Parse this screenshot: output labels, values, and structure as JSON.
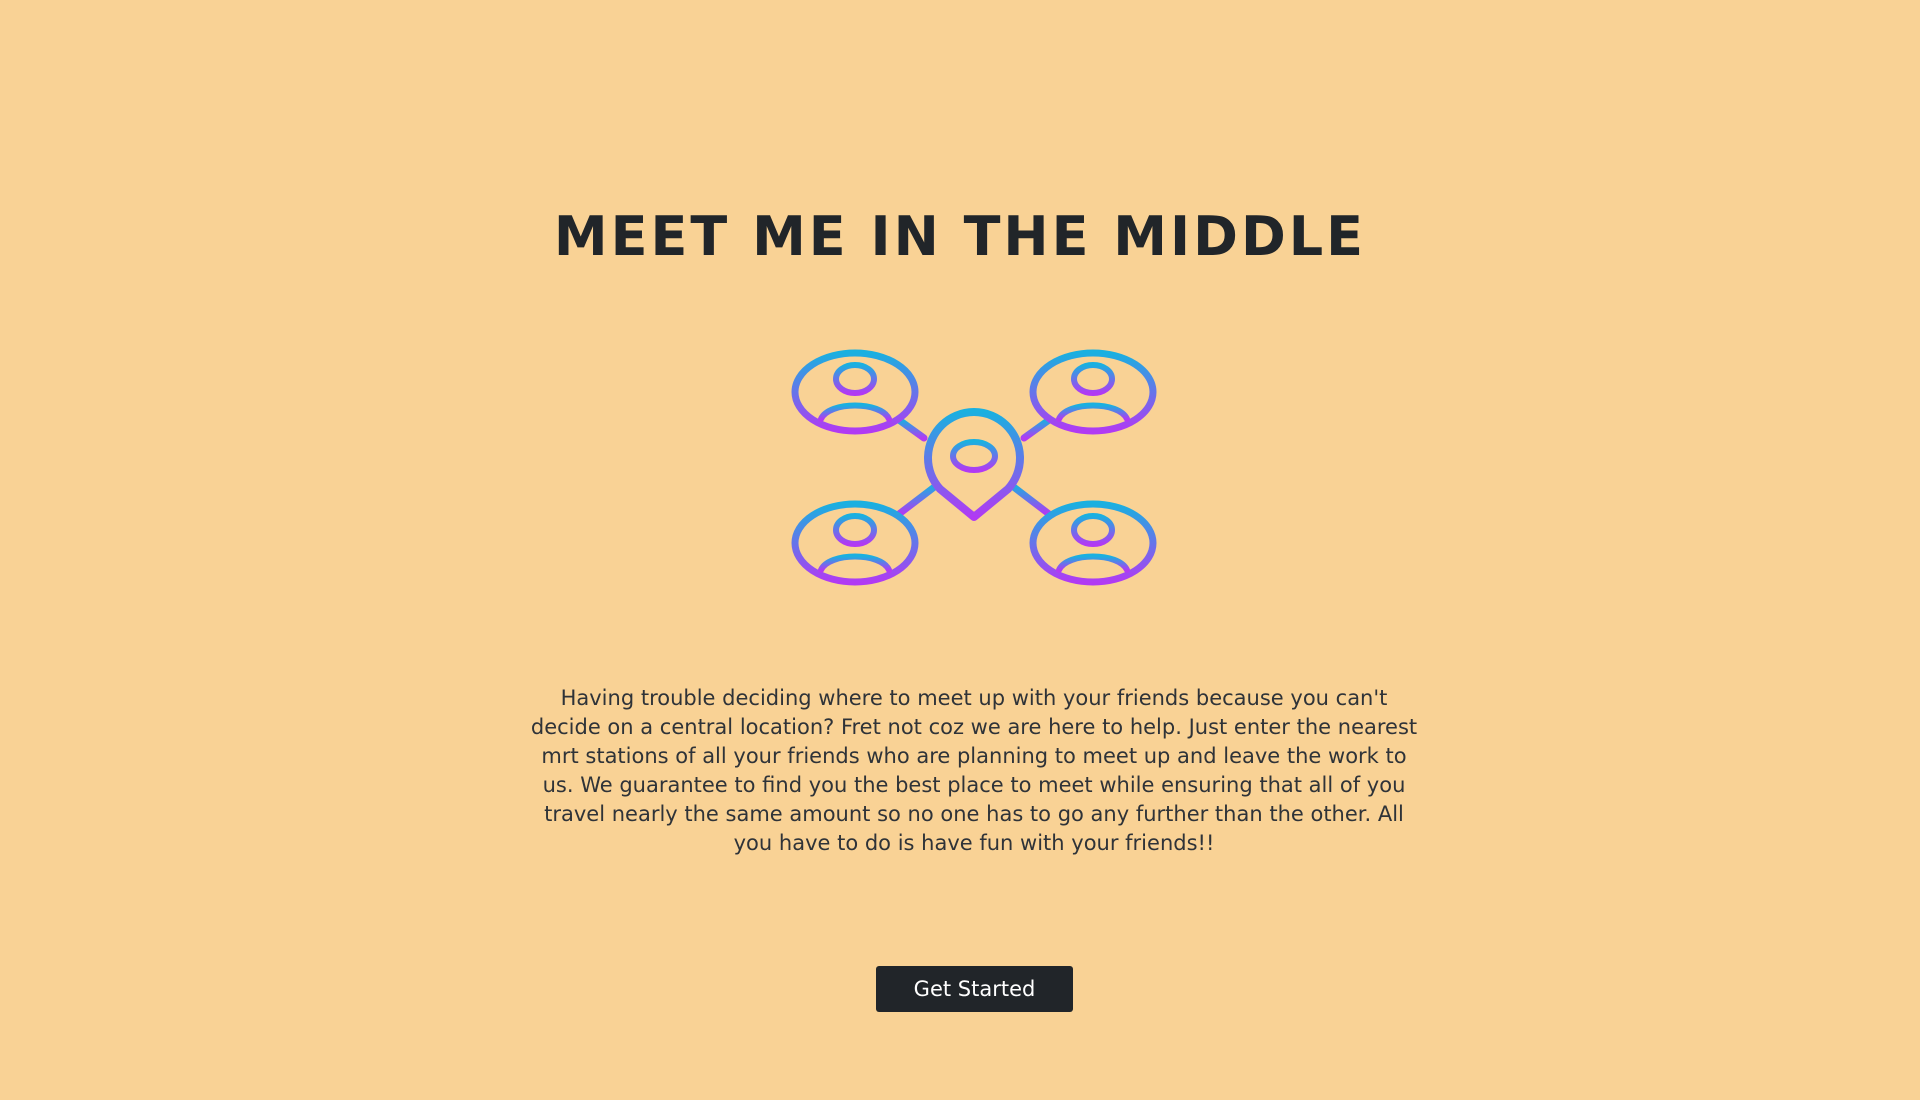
{
  "page": {
    "background_color": "#f9d295"
  },
  "hero": {
    "title": "MEET ME IN THE MIDDLE",
    "logo_icon": "meetup-location-network-icon",
    "logo_gradient": [
      "#1ab0e0",
      "#b13af3"
    ],
    "description": "Having trouble deciding where to meet up with your friends because you can't decide on a central location? Fret not coz we are here to help. Just enter the nearest mrt stations of all your friends who are planning to meet up and leave the work to us. We guarantee to find you the best place to meet while ensuring that all of you travel nearly the same amount so no one has to go any further than the other. All you have to do is have fun with your friends!!",
    "cta_label": "Get Started"
  }
}
